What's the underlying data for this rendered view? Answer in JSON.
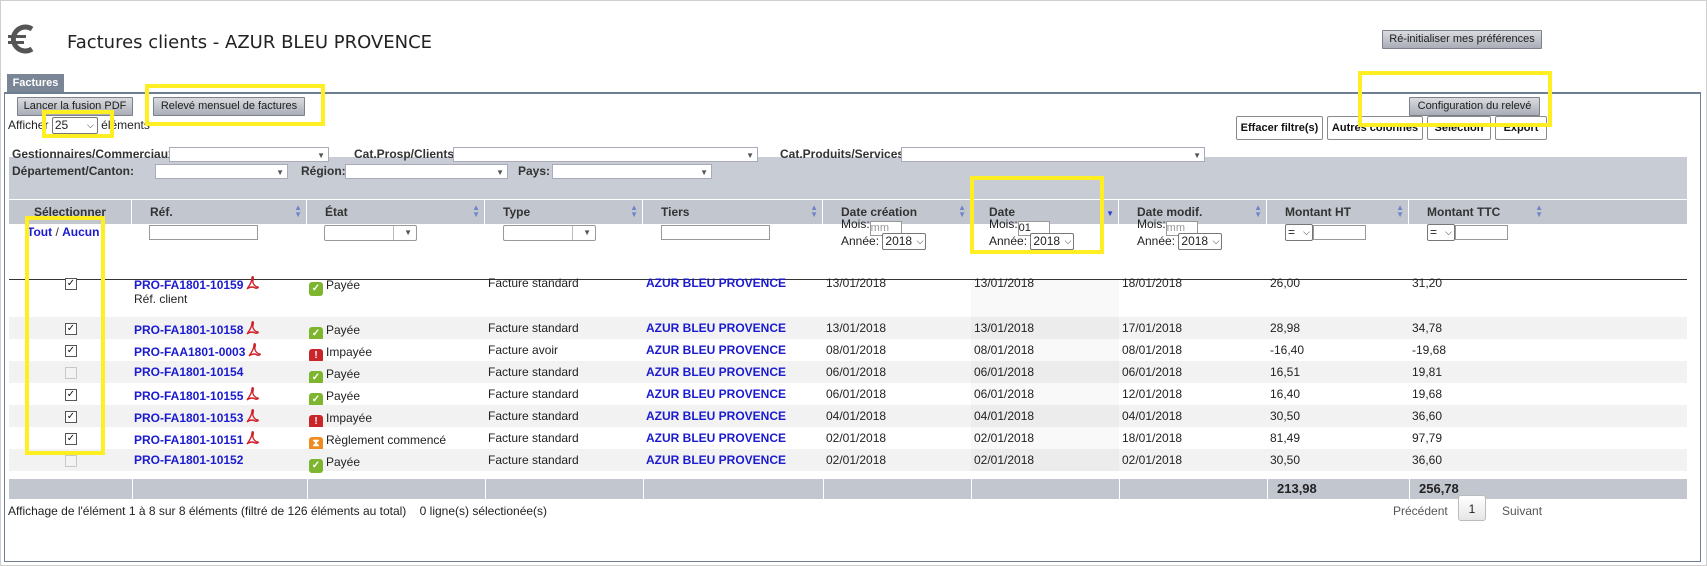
{
  "page": {
    "title": "Factures clients - AZUR BLEU PROVENCE",
    "reset_prefs": "Ré-initialiser mes préférences",
    "tab": "Factures"
  },
  "toolbar": {
    "fusion_pdf": "Lancer la fusion PDF",
    "releve_mensuel": "Relevé mensuel de factures",
    "config_releve": "Configuration du relevé",
    "show_prefix": "Afficher",
    "show_value": "25",
    "show_suffix": "éléments",
    "clear_filters": "Effacer filtre(s)",
    "other_columns": "Autres colonnes",
    "selection": "Sélection",
    "export": "Export"
  },
  "filters": {
    "gestionnaires": "Gestionnaires/Commerciaux:",
    "catprosp": "Cat.Prosp/Clients:",
    "catproduits": "Cat.Produits/Services:",
    "departement": "Département/Canton:",
    "region": "Région:",
    "pays": "Pays:"
  },
  "columns": {
    "select": "Sélectionner",
    "ref": "Réf.",
    "etat": "État",
    "type": "Type",
    "tiers": "Tiers",
    "date_creation": "Date création",
    "date": "Date",
    "date_modif": "Date modif.",
    "montant_ht": "Montant HT",
    "montant_ttc": "Montant TTC"
  },
  "column_filters": {
    "tout": "Tout",
    "separator": " / ",
    "aucun": "Aucun",
    "mois_label": "Mois:",
    "mois_placeholder": "mm",
    "annee_label": "Année:",
    "annee_value": "2018",
    "date_mois_value": "01",
    "operator": "="
  },
  "rows": [
    {
      "ref": "PRO-FA1801-10159",
      "sub": "Réf. client",
      "pdf": true,
      "status": "ok",
      "etat": "Payée",
      "type": "Facture standard",
      "tiers": "AZUR BLEU PROVENCE",
      "date_creation": "13/01/2018",
      "date": "13/01/2018",
      "date_modif": "18/01/2018",
      "ht": "26,00",
      "ttc": "31,20",
      "checked": true
    },
    {
      "ref": "PRO-FA1801-10158",
      "sub": "",
      "pdf": true,
      "status": "ok",
      "etat": "Payée",
      "type": "Facture standard",
      "tiers": "AZUR BLEU PROVENCE",
      "date_creation": "13/01/2018",
      "date": "13/01/2018",
      "date_modif": "17/01/2018",
      "ht": "28,98",
      "ttc": "34,78",
      "checked": true
    },
    {
      "ref": "PRO-FAA1801-0003",
      "sub": "",
      "pdf": true,
      "status": "ko",
      "etat": "Impayée",
      "type": "Facture avoir",
      "tiers": "AZUR BLEU PROVENCE",
      "date_creation": "08/01/2018",
      "date": "08/01/2018",
      "date_modif": "08/01/2018",
      "ht": "-16,40",
      "ttc": "-19,68",
      "checked": true
    },
    {
      "ref": "PRO-FA1801-10154",
      "sub": "",
      "pdf": false,
      "status": "ok",
      "etat": "Payée",
      "type": "Facture standard",
      "tiers": "AZUR BLEU PROVENCE",
      "date_creation": "06/01/2018",
      "date": "06/01/2018",
      "date_modif": "06/01/2018",
      "ht": "16,51",
      "ttc": "19,81",
      "checked": false
    },
    {
      "ref": "PRO-FA1801-10155",
      "sub": "",
      "pdf": true,
      "status": "ok",
      "etat": "Payée",
      "type": "Facture standard",
      "tiers": "AZUR BLEU PROVENCE",
      "date_creation": "06/01/2018",
      "date": "06/01/2018",
      "date_modif": "12/01/2018",
      "ht": "16,40",
      "ttc": "19,68",
      "checked": true
    },
    {
      "ref": "PRO-FA1801-10153",
      "sub": "",
      "pdf": true,
      "status": "ko",
      "etat": "Impayée",
      "type": "Facture standard",
      "tiers": "AZUR BLEU PROVENCE",
      "date_creation": "04/01/2018",
      "date": "04/01/2018",
      "date_modif": "04/01/2018",
      "ht": "30,50",
      "ttc": "36,60",
      "checked": true
    },
    {
      "ref": "PRO-FA1801-10151",
      "sub": "",
      "pdf": true,
      "status": "part",
      "etat": "Règlement commencé",
      "type": "Facture standard",
      "tiers": "AZUR BLEU PROVENCE",
      "date_creation": "02/01/2018",
      "date": "02/01/2018",
      "date_modif": "18/01/2018",
      "ht": "81,49",
      "ttc": "97,79",
      "checked": true
    },
    {
      "ref": "PRO-FA1801-10152",
      "sub": "",
      "pdf": false,
      "status": "ok",
      "etat": "Payée",
      "type": "Facture standard",
      "tiers": "AZUR BLEU PROVENCE",
      "date_creation": "02/01/2018",
      "date": "02/01/2018",
      "date_modif": "02/01/2018",
      "ht": "30,50",
      "ttc": "36,60",
      "checked": false
    }
  ],
  "totals": {
    "ht": "213,98",
    "ttc": "256,78"
  },
  "footer": {
    "info": "Affichage de l'élément 1 à 8 sur 8 éléments (filtré de 126 éléments au total)",
    "selected": "0 ligne(s) sélectionée(s)",
    "prev": "Précédent",
    "page": "1",
    "next": "Suivant"
  },
  "colors": {
    "link": "#1a1ad0",
    "highlight": "#ffef22",
    "header": "#c1c6cf",
    "paid": "#7db52e",
    "unpaid": "#c9262a",
    "partial": "#f08b1f"
  }
}
